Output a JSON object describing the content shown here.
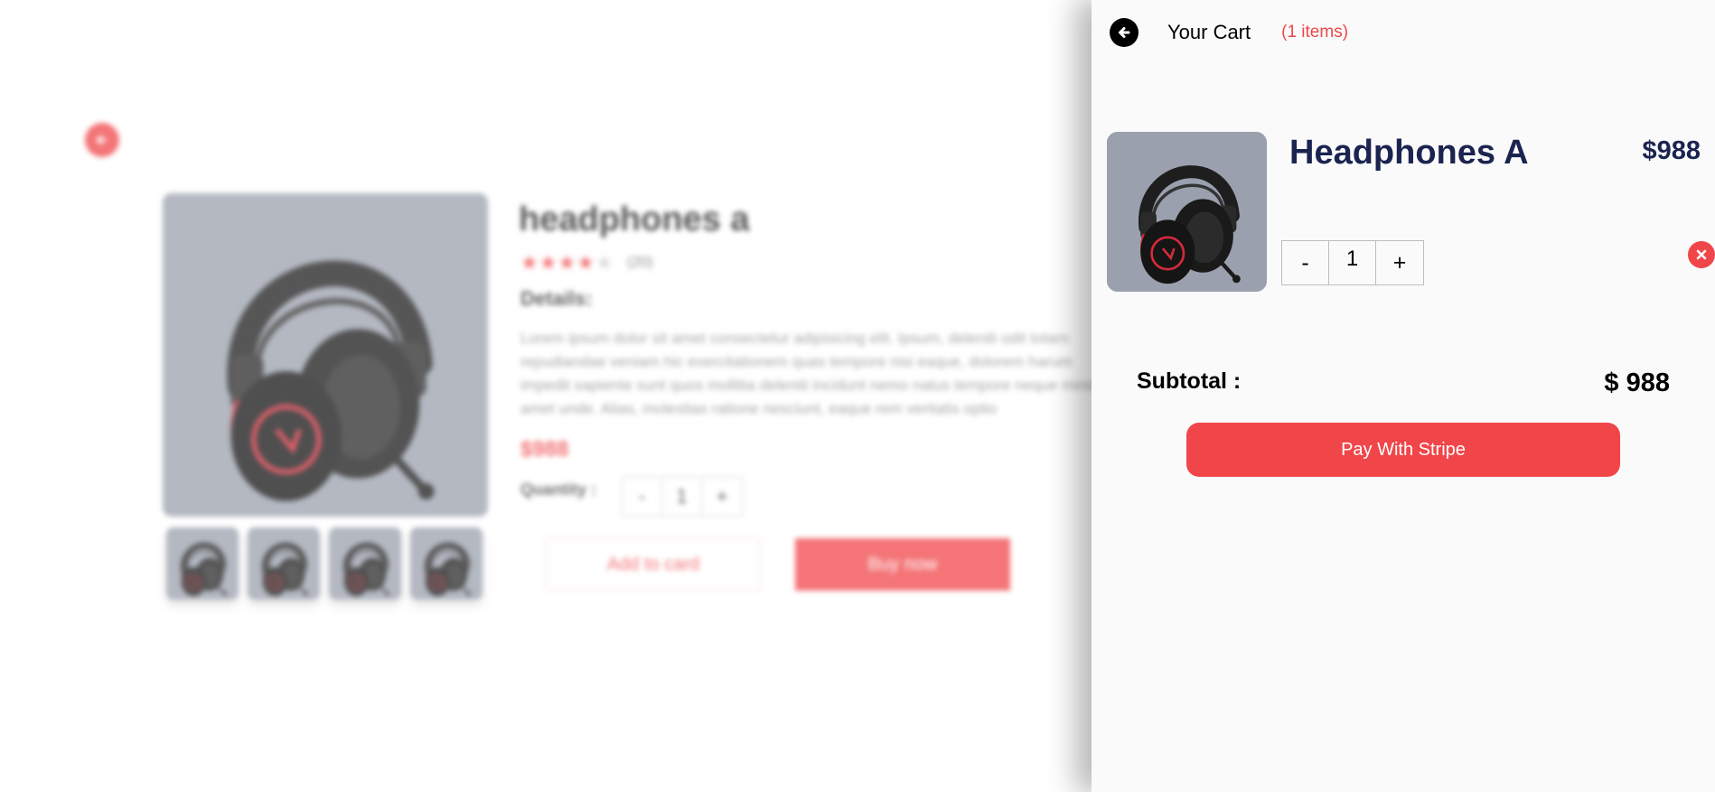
{
  "background_page": {
    "product_title": "headphones a",
    "reviews": "(20)",
    "details_label": "Details:",
    "description": "Lorem ipsum dolor sit amet consectetur adipisicing elit. Ipsum, deleniti odit totam repudiandae veniam hic exercitationem quas tempore nisi eaque, dolorem harum impedit sapiente sunt quos mollitia deleniti incidunt nemo natus tempore neque minima amet unde. Alias, molestias ratione nesciunt, eaque rem veritatis optio",
    "price": "$988",
    "quantity_label": "Quantity :",
    "quantity": {
      "minus": "-",
      "value": "1",
      "plus": "+"
    },
    "add_to_cart_label": "Add to card",
    "buy_now_label": "Buy now",
    "rating": 4,
    "rating_max": 5
  },
  "cart": {
    "title": "Your Cart",
    "count_label": "(1 items)",
    "item": {
      "name": "Headphones A",
      "price": "$988",
      "minus": "-",
      "quantity": "1",
      "plus": "+"
    },
    "subtotal_label": "Subtotal :",
    "subtotal_value": "$ 988",
    "pay_button_label": "Pay With Stripe"
  },
  "icons": {
    "back": "arrow-left-circle-icon",
    "remove": "close-circle-icon"
  },
  "colors": {
    "accent": "#f0464a",
    "navy": "#1b2450",
    "image_bg": "#9aa0ad"
  }
}
